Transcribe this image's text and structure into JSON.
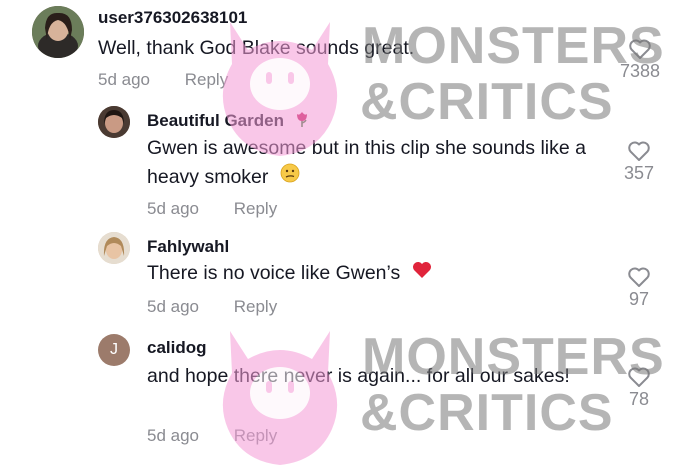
{
  "comments": [
    {
      "username": "user376302638101",
      "text": "Well, thank God Blake sounds great.",
      "time": "5d ago",
      "reply_label": "Reply",
      "likes": "7388",
      "avatar": "photo"
    },
    {
      "username": "Beautiful Garden",
      "username_emoji": "rose-icon",
      "text": "Gwen is awesome but in this clip she sounds like a heavy smoker",
      "text_emoji": "confused-face-icon",
      "time": "5d ago",
      "reply_label": "Reply",
      "likes": "357",
      "avatar": "photo"
    },
    {
      "username": "Fahlywahl",
      "text": "There is no voice like Gwen’s",
      "text_emoji": "red-heart-icon",
      "time": "5d ago",
      "reply_label": "Reply",
      "likes": "97",
      "avatar": "photo"
    },
    {
      "username": "calidog",
      "text": "and hope there never is again... for all our sakes!",
      "time": "5d ago",
      "reply_label": "Reply",
      "likes": "78",
      "avatar_initial": "J",
      "avatar_color": "#9c7b6b"
    }
  ],
  "watermark": {
    "line1": "MONSTERS",
    "line2": "&CRITICS"
  },
  "colors": {
    "text": "#161823",
    "muted": "#8a8b91",
    "heart": "#d01e3a",
    "watermark_pink": "#f7a8d8"
  }
}
